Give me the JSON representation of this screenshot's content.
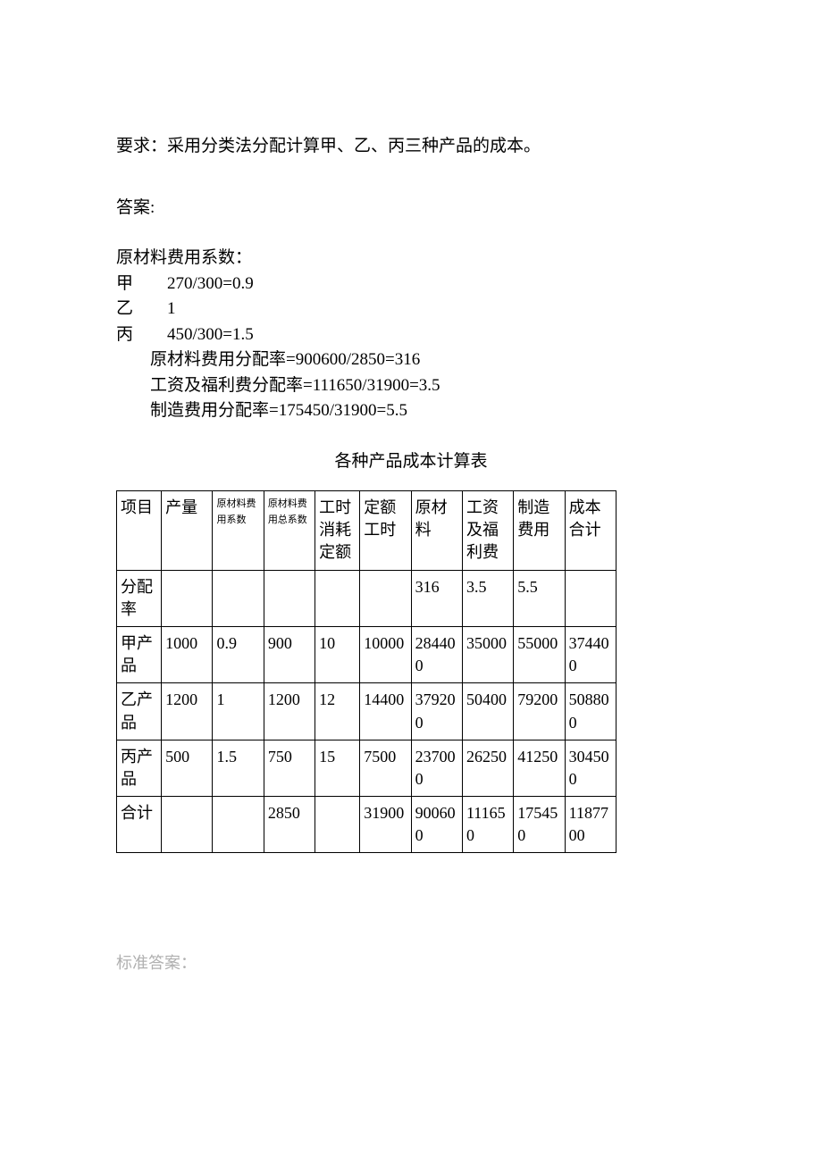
{
  "requirement": "要求：采用分类法分配计算甲、乙、丙三种产品的成本。",
  "answer_label": "答案:",
  "coeff_heading": "原材料费用系数：",
  "coeff_lines": {
    "jia": "甲  270/300=0.9",
    "yi": "乙  1",
    "bing": "丙  450/300=1.5"
  },
  "rate_lines": {
    "r1": "原材料费用分配率=900600/2850=316",
    "r2": "工资及福利费分配率=111650/31900=3.5",
    "r3": "制造费用分配率=175450/31900=5.5"
  },
  "table_title": "各种产品成本计算表",
  "headers": {
    "project": "项目",
    "output": "产量",
    "coeff_small": "原材料费用系数",
    "total_coeff_small": "原材料费用总系数",
    "hour_norm": "工时消耗定额",
    "quota_hour": "定额工时",
    "raw": "原材料",
    "wage": "工资及福利费",
    "mfg": "制造费用",
    "sum": "成本合计"
  },
  "rows": {
    "alloc_rate": {
      "label": "分配率",
      "output": "",
      "coeff": "",
      "total_coeff": "",
      "hour_norm": "",
      "quota_hour": "",
      "raw": "316",
      "wage": "3.5",
      "mfg": "5.5",
      "sum": ""
    },
    "jia": {
      "label": "甲产品",
      "output": "1000",
      "coeff": "0.9",
      "total_coeff": "900",
      "hour_norm": "10",
      "quota_hour": "10000",
      "raw": "284400",
      "wage": "35000",
      "mfg": "55000",
      "sum": "374400"
    },
    "yi": {
      "label": "乙产品",
      "output": "1200",
      "coeff": "1",
      "total_coeff": "1200",
      "hour_norm": "12",
      "quota_hour": "14400",
      "raw": "379200",
      "wage": "50400",
      "mfg": "79200",
      "sum": "508800"
    },
    "bing": {
      "label": "丙产品",
      "output": "500",
      "coeff": "1.5",
      "total_coeff": "750",
      "hour_norm": "15",
      "quota_hour": "7500",
      "raw": "237000",
      "wage": "26250",
      "mfg": "41250",
      "sum": "304500"
    },
    "total": {
      "label": "合计",
      "output": "",
      "coeff": "",
      "total_coeff": "2850",
      "hour_norm": "",
      "quota_hour": "31900",
      "raw": "900600",
      "wage": "111650",
      "mfg": "175450",
      "sum": "1187700"
    }
  },
  "footer_label": "标准答案："
}
